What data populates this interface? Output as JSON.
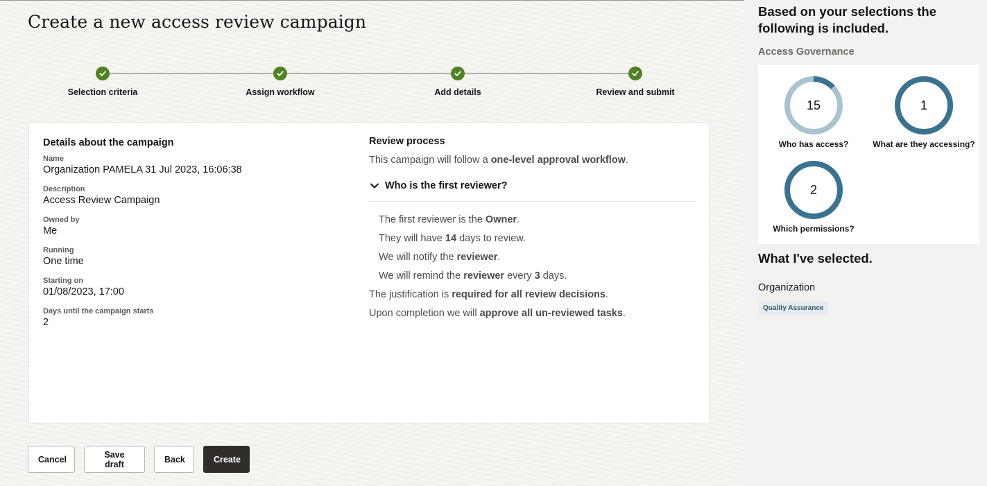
{
  "page": {
    "title": "Create a new access review campaign"
  },
  "stepper": {
    "steps": [
      {
        "label": "Selection criteria",
        "status": "complete"
      },
      {
        "label": "Assign workflow",
        "status": "complete"
      },
      {
        "label": "Add details",
        "status": "complete"
      },
      {
        "label": "Review and submit",
        "status": "complete"
      }
    ]
  },
  "details": {
    "title": "Details about the campaign",
    "fields": [
      {
        "label": "Name",
        "value": "Organization PAMELA 31 Jul 2023, 16:06:38"
      },
      {
        "label": "Description",
        "value": "Access Review Campaign"
      },
      {
        "label": "Owned by",
        "value": "Me"
      },
      {
        "label": "Running",
        "value": "One time"
      },
      {
        "label": "Starting on",
        "value": "01/08/2023, 17:00"
      },
      {
        "label": "Days until the campaign starts",
        "value": "2"
      }
    ]
  },
  "review": {
    "title": "Review process",
    "intro": {
      "pre": "This campaign will follow a ",
      "bold": "one-level approval workflow",
      "post": "."
    },
    "accordion_title": "Who is the first reviewer?",
    "lines": [
      {
        "pre": "The first reviewer is the ",
        "bold": "Owner",
        "post": "."
      },
      {
        "pre": "They will have ",
        "bold": "14",
        "post": " days to review."
      },
      {
        "pre": "We will notify the ",
        "bold": "reviewer",
        "post": "."
      },
      {
        "pre": "We will remind the ",
        "bold": "reviewer",
        "mid": " every ",
        "bold2": "3",
        "post": " days."
      }
    ],
    "justification": {
      "pre": "The justification is ",
      "bold": "required for all review decisions",
      "post": "."
    },
    "completion": {
      "pre": "Upon completion we will ",
      "bold": "approve all un-reviewed tasks",
      "post": "."
    }
  },
  "actions": {
    "cancel": "Cancel",
    "save_draft": "Save draft",
    "back": "Back",
    "create": "Create"
  },
  "side": {
    "title": "Based on your selections the following is included.",
    "subtitle": "Access Governance",
    "metrics": [
      {
        "value": "15",
        "label": "Who has access?",
        "fill_fraction": 0.13
      },
      {
        "value": "1",
        "label": "What are they accessing?",
        "fill_fraction": 1.0
      },
      {
        "value": "2",
        "label": "Which permissions?",
        "fill_fraction": 1.0
      }
    ],
    "selected_title": "What I've selected.",
    "selected_category": "Organization",
    "selected_tag": "Quality Assurance"
  },
  "colors": {
    "step_complete": "#508223",
    "ring_dark": "#3a7390",
    "ring_light": "#a9c3d1",
    "primary_button": "#312d2a"
  },
  "icons": {
    "step": "check-icon",
    "accordion": "chevron-down-icon"
  }
}
